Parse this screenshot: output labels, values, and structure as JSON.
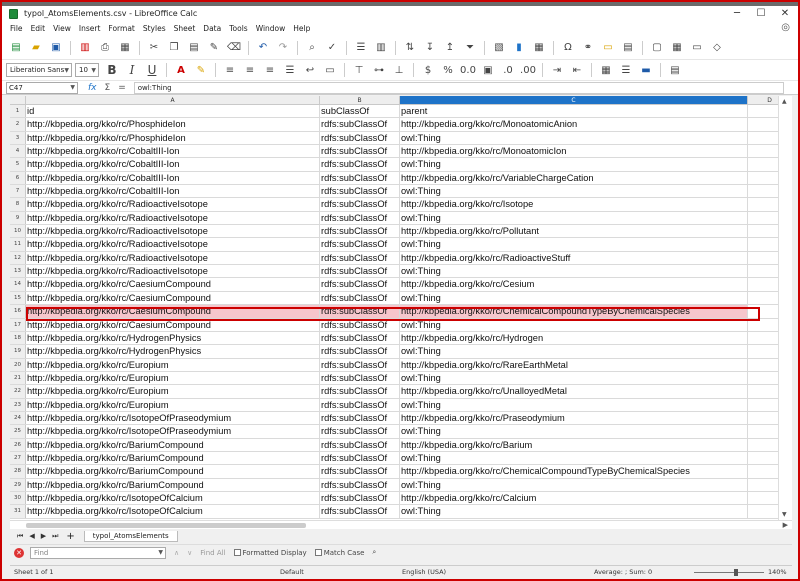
{
  "window": {
    "title": "typol_AtomsElements.csv - LibreOffice Calc",
    "min": "─",
    "max": "☐",
    "close": "✕"
  },
  "menu": [
    "File",
    "Edit",
    "View",
    "Insert",
    "Format",
    "Styles",
    "Sheet",
    "Data",
    "Tools",
    "Window",
    "Help"
  ],
  "formatting": {
    "font_name": "Liberation Sans",
    "font_size": "10"
  },
  "formula_bar": {
    "cell_ref": "C47",
    "content": "owl:Thing",
    "fx": "fx",
    "sum": "Σ",
    "eq": "="
  },
  "columns": [
    "A",
    "B",
    "C",
    "D"
  ],
  "rows": [
    {
      "n": "1",
      "a": "id",
      "b": "subClassOf",
      "c": "parent"
    },
    {
      "n": "2",
      "a": "http://kbpedia.org/kko/rc/PhosphideIon",
      "b": "rdfs:subClassOf",
      "c": "http://kbpedia.org/kko/rc/MonoatomicAnion"
    },
    {
      "n": "3",
      "a": "http://kbpedia.org/kko/rc/PhosphideIon",
      "b": "rdfs:subClassOf",
      "c": "owl:Thing"
    },
    {
      "n": "4",
      "a": "http://kbpedia.org/kko/rc/CobaltIII-Ion",
      "b": "rdfs:subClassOf",
      "c": "http://kbpedia.org/kko/rc/MonoatomicIon"
    },
    {
      "n": "5",
      "a": "http://kbpedia.org/kko/rc/CobaltIII-Ion",
      "b": "rdfs:subClassOf",
      "c": "owl:Thing"
    },
    {
      "n": "6",
      "a": "http://kbpedia.org/kko/rc/CobaltIII-Ion",
      "b": "rdfs:subClassOf",
      "c": "http://kbpedia.org/kko/rc/VariableChargeCation"
    },
    {
      "n": "7",
      "a": "http://kbpedia.org/kko/rc/CobaltIII-Ion",
      "b": "rdfs:subClassOf",
      "c": "owl:Thing"
    },
    {
      "n": "8",
      "a": "http://kbpedia.org/kko/rc/RadioactiveIsotope",
      "b": "rdfs:subClassOf",
      "c": "http://kbpedia.org/kko/rc/Isotope"
    },
    {
      "n": "9",
      "a": "http://kbpedia.org/kko/rc/RadioactiveIsotope",
      "b": "rdfs:subClassOf",
      "c": "owl:Thing"
    },
    {
      "n": "10",
      "a": "http://kbpedia.org/kko/rc/RadioactiveIsotope",
      "b": "rdfs:subClassOf",
      "c": "http://kbpedia.org/kko/rc/Pollutant"
    },
    {
      "n": "11",
      "a": "http://kbpedia.org/kko/rc/RadioactiveIsotope",
      "b": "rdfs:subClassOf",
      "c": "owl:Thing"
    },
    {
      "n": "12",
      "a": "http://kbpedia.org/kko/rc/RadioactiveIsotope",
      "b": "rdfs:subClassOf",
      "c": "http://kbpedia.org/kko/rc/RadioactiveStuff"
    },
    {
      "n": "13",
      "a": "http://kbpedia.org/kko/rc/RadioactiveIsotope",
      "b": "rdfs:subClassOf",
      "c": "owl:Thing"
    },
    {
      "n": "14",
      "a": "http://kbpedia.org/kko/rc/CaesiumCompound",
      "b": "rdfs:subClassOf",
      "c": "http://kbpedia.org/kko/rc/Cesium"
    },
    {
      "n": "15",
      "a": "http://kbpedia.org/kko/rc/CaesiumCompound",
      "b": "rdfs:subClassOf",
      "c": "owl:Thing"
    },
    {
      "n": "16",
      "a": "http://kbpedia.org/kko/rc/CaesiumCompound",
      "b": "rdfs:subClassOf",
      "c": "http://kbpedia.org/kko/rc/ChemicalCompoundTypeByChemicalSpecies"
    },
    {
      "n": "17",
      "a": "http://kbpedia.org/kko/rc/CaesiumCompound",
      "b": "rdfs:subClassOf",
      "c": "owl:Thing"
    },
    {
      "n": "18",
      "a": "http://kbpedia.org/kko/rc/HydrogenPhysics",
      "b": "rdfs:subClassOf",
      "c": "http://kbpedia.org/kko/rc/Hydrogen"
    },
    {
      "n": "19",
      "a": "http://kbpedia.org/kko/rc/HydrogenPhysics",
      "b": "rdfs:subClassOf",
      "c": "owl:Thing"
    },
    {
      "n": "20",
      "a": "http://kbpedia.org/kko/rc/Europium",
      "b": "rdfs:subClassOf",
      "c": "http://kbpedia.org/kko/rc/RareEarthMetal"
    },
    {
      "n": "21",
      "a": "http://kbpedia.org/kko/rc/Europium",
      "b": "rdfs:subClassOf",
      "c": "owl:Thing"
    },
    {
      "n": "22",
      "a": "http://kbpedia.org/kko/rc/Europium",
      "b": "rdfs:subClassOf",
      "c": "http://kbpedia.org/kko/rc/UnalloyedMetal"
    },
    {
      "n": "23",
      "a": "http://kbpedia.org/kko/rc/Europium",
      "b": "rdfs:subClassOf",
      "c": "owl:Thing"
    },
    {
      "n": "24",
      "a": "http://kbpedia.org/kko/rc/IsotopeOfPraseodymium",
      "b": "rdfs:subClassOf",
      "c": "http://kbpedia.org/kko/rc/Praseodymium"
    },
    {
      "n": "25",
      "a": "http://kbpedia.org/kko/rc/IsotopeOfPraseodymium",
      "b": "rdfs:subClassOf",
      "c": "owl:Thing"
    },
    {
      "n": "26",
      "a": "http://kbpedia.org/kko/rc/BariumCompound",
      "b": "rdfs:subClassOf",
      "c": "http://kbpedia.org/kko/rc/Barium"
    },
    {
      "n": "27",
      "a": "http://kbpedia.org/kko/rc/BariumCompound",
      "b": "rdfs:subClassOf",
      "c": "owl:Thing"
    },
    {
      "n": "28",
      "a": "http://kbpedia.org/kko/rc/BariumCompound",
      "b": "rdfs:subClassOf",
      "c": "http://kbpedia.org/kko/rc/ChemicalCompoundTypeByChemicalSpecies"
    },
    {
      "n": "29",
      "a": "http://kbpedia.org/kko/rc/BariumCompound",
      "b": "rdfs:subClassOf",
      "c": "owl:Thing"
    },
    {
      "n": "30",
      "a": "http://kbpedia.org/kko/rc/IsotopeOfCalcium",
      "b": "rdfs:subClassOf",
      "c": "http://kbpedia.org/kko/rc/Calcium"
    },
    {
      "n": "31",
      "a": "http://kbpedia.org/kko/rc/IsotopeOfCalcium",
      "b": "rdfs:subClassOf",
      "c": "owl:Thing"
    }
  ],
  "selected_row": "16",
  "sheet_tab": "typol_AtomsElements",
  "find": {
    "placeholder": "Find",
    "find_all": "Find All",
    "formatted_display": "Formatted Display",
    "match_case": "Match Case"
  },
  "status": {
    "sheet": "Sheet 1 of 1",
    "style": "Default",
    "language": "English (USA)",
    "summary": "Average: ; Sum: 0",
    "zoom": "140%"
  },
  "colors": {
    "accent": "#1e73c8",
    "highlight_border": "#cc0000",
    "selected_fill": "#f6c6cc"
  }
}
